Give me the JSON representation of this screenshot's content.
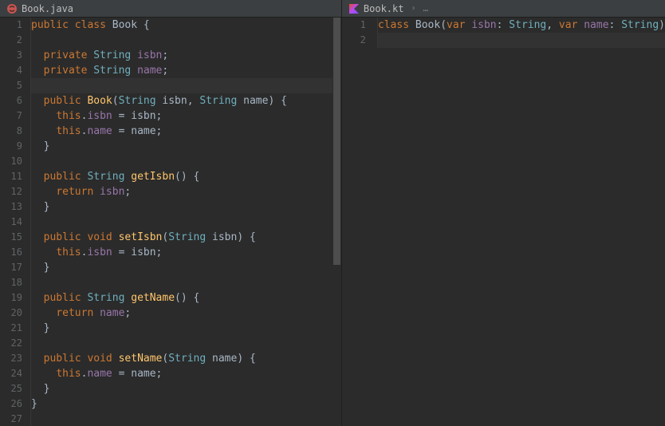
{
  "left": {
    "filename": "Book.java",
    "icon": "java-class-icon",
    "lines": [
      [
        {
          "t": "public ",
          "c": "kw"
        },
        {
          "t": "class ",
          "c": "kw"
        },
        {
          "t": "Book ",
          "c": "type"
        },
        {
          "t": "{",
          "c": "punct"
        }
      ],
      [],
      [
        {
          "t": "  ",
          "c": ""
        },
        {
          "t": "private ",
          "c": "kw"
        },
        {
          "t": "String ",
          "c": "str-type"
        },
        {
          "t": "isbn",
          "c": "field"
        },
        {
          "t": ";",
          "c": "punct"
        }
      ],
      [
        {
          "t": "  ",
          "c": ""
        },
        {
          "t": "private ",
          "c": "kw"
        },
        {
          "t": "String ",
          "c": "str-type"
        },
        {
          "t": "name",
          "c": "field"
        },
        {
          "t": ";",
          "c": "punct"
        }
      ],
      [],
      [
        {
          "t": "  ",
          "c": ""
        },
        {
          "t": "public ",
          "c": "kw"
        },
        {
          "t": "Book",
          "c": "method"
        },
        {
          "t": "(",
          "c": "punct"
        },
        {
          "t": "String ",
          "c": "str-type"
        },
        {
          "t": "isbn",
          "c": "param"
        },
        {
          "t": ", ",
          "c": "punct"
        },
        {
          "t": "String ",
          "c": "str-type"
        },
        {
          "t": "name",
          "c": "param"
        },
        {
          "t": ") {",
          "c": "punct"
        }
      ],
      [
        {
          "t": "    ",
          "c": ""
        },
        {
          "t": "this",
          "c": "this"
        },
        {
          "t": ".",
          "c": "punct"
        },
        {
          "t": "isbn",
          "c": "field"
        },
        {
          "t": " = isbn;",
          "c": "punct"
        }
      ],
      [
        {
          "t": "    ",
          "c": ""
        },
        {
          "t": "this",
          "c": "this"
        },
        {
          "t": ".",
          "c": "punct"
        },
        {
          "t": "name",
          "c": "field"
        },
        {
          "t": " = name;",
          "c": "punct"
        }
      ],
      [
        {
          "t": "  }",
          "c": "punct"
        }
      ],
      [],
      [
        {
          "t": "  ",
          "c": ""
        },
        {
          "t": "public ",
          "c": "kw"
        },
        {
          "t": "String ",
          "c": "str-type"
        },
        {
          "t": "getIsbn",
          "c": "method"
        },
        {
          "t": "() {",
          "c": "punct"
        }
      ],
      [
        {
          "t": "    ",
          "c": ""
        },
        {
          "t": "return ",
          "c": "kw"
        },
        {
          "t": "isbn",
          "c": "field"
        },
        {
          "t": ";",
          "c": "punct"
        }
      ],
      [
        {
          "t": "  }",
          "c": "punct"
        }
      ],
      [],
      [
        {
          "t": "  ",
          "c": ""
        },
        {
          "t": "public ",
          "c": "kw"
        },
        {
          "t": "void ",
          "c": "kw"
        },
        {
          "t": "setIsbn",
          "c": "method"
        },
        {
          "t": "(",
          "c": "punct"
        },
        {
          "t": "String ",
          "c": "str-type"
        },
        {
          "t": "isbn",
          "c": "param"
        },
        {
          "t": ") {",
          "c": "punct"
        }
      ],
      [
        {
          "t": "    ",
          "c": ""
        },
        {
          "t": "this",
          "c": "this"
        },
        {
          "t": ".",
          "c": "punct"
        },
        {
          "t": "isbn",
          "c": "field"
        },
        {
          "t": " = isbn;",
          "c": "punct"
        }
      ],
      [
        {
          "t": "  }",
          "c": "punct"
        }
      ],
      [],
      [
        {
          "t": "  ",
          "c": ""
        },
        {
          "t": "public ",
          "c": "kw"
        },
        {
          "t": "String ",
          "c": "str-type"
        },
        {
          "t": "getName",
          "c": "method"
        },
        {
          "t": "() {",
          "c": "punct"
        }
      ],
      [
        {
          "t": "    ",
          "c": ""
        },
        {
          "t": "return ",
          "c": "kw"
        },
        {
          "t": "name",
          "c": "field"
        },
        {
          "t": ";",
          "c": "punct"
        }
      ],
      [
        {
          "t": "  }",
          "c": "punct"
        }
      ],
      [],
      [
        {
          "t": "  ",
          "c": ""
        },
        {
          "t": "public ",
          "c": "kw"
        },
        {
          "t": "void ",
          "c": "kw"
        },
        {
          "t": "setName",
          "c": "method"
        },
        {
          "t": "(",
          "c": "punct"
        },
        {
          "t": "String ",
          "c": "str-type"
        },
        {
          "t": "name",
          "c": "param"
        },
        {
          "t": ") {",
          "c": "punct"
        }
      ],
      [
        {
          "t": "    ",
          "c": ""
        },
        {
          "t": "this",
          "c": "this"
        },
        {
          "t": ".",
          "c": "punct"
        },
        {
          "t": "name",
          "c": "field"
        },
        {
          "t": " = name;",
          "c": "punct"
        }
      ],
      [
        {
          "t": "  }",
          "c": "punct"
        }
      ],
      [
        {
          "t": "}",
          "c": "punct"
        }
      ],
      []
    ],
    "current_line_index": 4
  },
  "right": {
    "filename": "Book.kt",
    "icon": "kotlin-file-icon",
    "breadcrumb_more": "…",
    "lines": [
      [
        {
          "t": "class ",
          "c": "kt-kw"
        },
        {
          "t": "Book",
          "c": "kt-class"
        },
        {
          "t": "(",
          "c": "punct"
        },
        {
          "t": "var ",
          "c": "kt-kw"
        },
        {
          "t": "isbn",
          "c": "field"
        },
        {
          "t": ": ",
          "c": "punct"
        },
        {
          "t": "String",
          "c": "kt-type"
        },
        {
          "t": ", ",
          "c": "punct"
        },
        {
          "t": "var ",
          "c": "kt-kw"
        },
        {
          "t": "name",
          "c": "field"
        },
        {
          "t": ": ",
          "c": "punct"
        },
        {
          "t": "String",
          "c": "kt-type"
        },
        {
          "t": ")",
          "c": "punct"
        }
      ],
      []
    ],
    "current_line_index": 1
  }
}
